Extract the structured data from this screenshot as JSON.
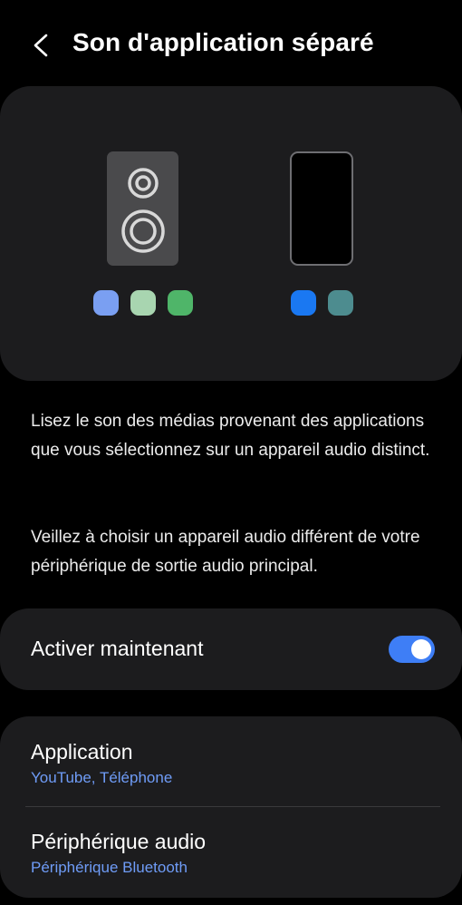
{
  "header": {
    "title": "Son d'application séparé",
    "back_icon": "chevron-left-icon"
  },
  "illustration": {
    "speaker_icon": "speaker-icon",
    "phone_icon": "phone-icon",
    "speaker_app_colors": [
      "#7a9ff2",
      "#a8d5b0",
      "#4fb569"
    ],
    "phone_app_colors": [
      "#1a78f2",
      "#4d8c8f"
    ]
  },
  "description": {
    "paragraph1": "Lisez le son des médias provenant des applications que vous sélectionnez sur un appareil audio distinct.",
    "paragraph2": "Veillez à choisir un appareil audio différent de votre périphérique de sortie audio principal."
  },
  "toggle": {
    "label": "Activer maintenant",
    "state": "on"
  },
  "settings": {
    "items": [
      {
        "title": "Application",
        "subtitle": "YouTube, Téléphone"
      },
      {
        "title": "Périphérique audio",
        "subtitle": "Périphérique Bluetooth"
      }
    ]
  },
  "colors": {
    "background": "#000000",
    "card": "#1c1c1e",
    "accent": "#3e7ef6",
    "link": "#6f9cf7"
  }
}
